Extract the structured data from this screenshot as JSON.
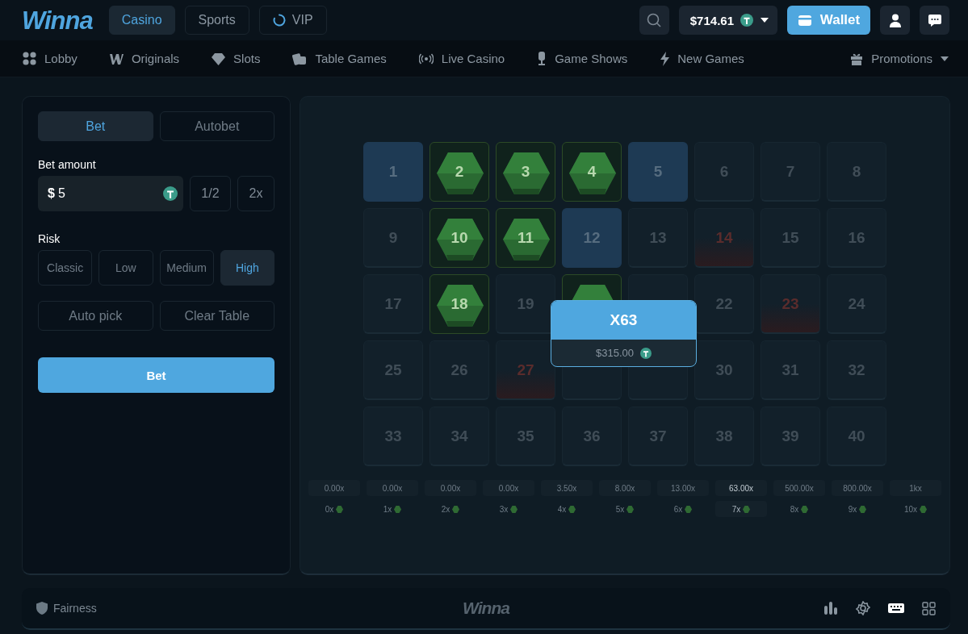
{
  "logo": "Winna",
  "top_tabs": [
    {
      "label": "Casino",
      "selected": true,
      "kind": "text"
    },
    {
      "label": "Sports",
      "selected": false,
      "kind": "text"
    },
    {
      "label": "VIP",
      "selected": false,
      "kind": "spinner"
    }
  ],
  "balance": "$714.61",
  "wallet": "Wallet",
  "nav": [
    {
      "label": "Lobby",
      "kind": "lobby"
    },
    {
      "label": "Originals",
      "kind": "originals"
    },
    {
      "label": "Slots",
      "kind": "slots"
    },
    {
      "label": "Table Games",
      "kind": "table"
    },
    {
      "label": "Live Casino",
      "kind": "live"
    },
    {
      "label": "Game Shows",
      "kind": "shows"
    },
    {
      "label": "New Games",
      "kind": "new"
    }
  ],
  "promotions": "Promotions",
  "bet_tabs": [
    {
      "label": "Bet",
      "selected": true
    },
    {
      "label": "Autobet",
      "selected": false
    }
  ],
  "bet_amount": {
    "label": "Bet amount",
    "currency": "$",
    "value": "5"
  },
  "amount_buttons": [
    "1/2",
    "2x"
  ],
  "risk": {
    "label": "Risk",
    "options": [
      {
        "label": "Classic",
        "selected": false
      },
      {
        "label": "Low",
        "selected": false
      },
      {
        "label": "Medium",
        "selected": false
      },
      {
        "label": "High",
        "selected": true
      }
    ]
  },
  "actions": [
    "Auto pick",
    "Clear Table"
  ],
  "bet_button": "Bet",
  "tiles": [
    {
      "label": "1",
      "kind": "picked"
    },
    {
      "label": "2",
      "kind": "hit"
    },
    {
      "label": "3",
      "kind": "hit"
    },
    {
      "label": "4",
      "kind": "hit"
    },
    {
      "label": "5",
      "kind": "picked"
    },
    {
      "label": "6",
      "kind": "empty"
    },
    {
      "label": "7",
      "kind": "empty"
    },
    {
      "label": "8",
      "kind": "empty"
    },
    {
      "label": "9",
      "kind": "empty"
    },
    {
      "label": "10",
      "kind": "hit"
    },
    {
      "label": "11",
      "kind": "hit"
    },
    {
      "label": "12",
      "kind": "picked"
    },
    {
      "label": "13",
      "kind": "empty"
    },
    {
      "label": "14",
      "kind": "miss"
    },
    {
      "label": "15",
      "kind": "empty"
    },
    {
      "label": "16",
      "kind": "empty"
    },
    {
      "label": "17",
      "kind": "empty"
    },
    {
      "label": "18",
      "kind": "hit"
    },
    {
      "label": "19",
      "kind": "empty"
    },
    {
      "kind": "hit"
    },
    {
      "kind": "empty"
    },
    {
      "label": "22",
      "kind": "empty"
    },
    {
      "label": "23",
      "kind": "miss"
    },
    {
      "label": "24",
      "kind": "empty"
    },
    {
      "label": "25",
      "kind": "empty"
    },
    {
      "label": "26",
      "kind": "empty"
    },
    {
      "label": "27",
      "kind": "miss"
    },
    {
      "kind": "empty"
    },
    {
      "kind": "empty"
    },
    {
      "label": "30",
      "kind": "empty"
    },
    {
      "label": "31",
      "kind": "empty"
    },
    {
      "label": "32",
      "kind": "empty"
    },
    {
      "label": "33",
      "kind": "empty"
    },
    {
      "label": "34",
      "kind": "empty"
    },
    {
      "label": "35",
      "kind": "empty"
    },
    {
      "label": "36",
      "kind": "empty"
    },
    {
      "label": "37",
      "kind": "empty"
    },
    {
      "label": "38",
      "kind": "empty"
    },
    {
      "label": "39",
      "kind": "empty"
    },
    {
      "label": "40",
      "kind": "empty"
    }
  ],
  "popup": {
    "multiplier": "X63",
    "payout": "$315.00"
  },
  "payouts": [
    {
      "multiplier": "0.00x",
      "hits": "0x",
      "selected": false
    },
    {
      "multiplier": "0.00x",
      "hits": "1x",
      "selected": false
    },
    {
      "multiplier": "0.00x",
      "hits": "2x",
      "selected": false
    },
    {
      "multiplier": "0.00x",
      "hits": "3x",
      "selected": false
    },
    {
      "multiplier": "3.50x",
      "hits": "4x",
      "selected": false
    },
    {
      "multiplier": "8.00x",
      "hits": "5x",
      "selected": false
    },
    {
      "multiplier": "13.00x",
      "hits": "6x",
      "selected": false
    },
    {
      "multiplier": "63.00x",
      "hits": "7x",
      "selected": true
    },
    {
      "multiplier": "500.00x",
      "hits": "8x",
      "selected": false
    },
    {
      "multiplier": "800.00x",
      "hits": "9x",
      "selected": false
    },
    {
      "multiplier": "1kx",
      "hits": "10x",
      "selected": false
    }
  ],
  "footer": {
    "fairness": "Fairness",
    "logo": "Winna"
  }
}
